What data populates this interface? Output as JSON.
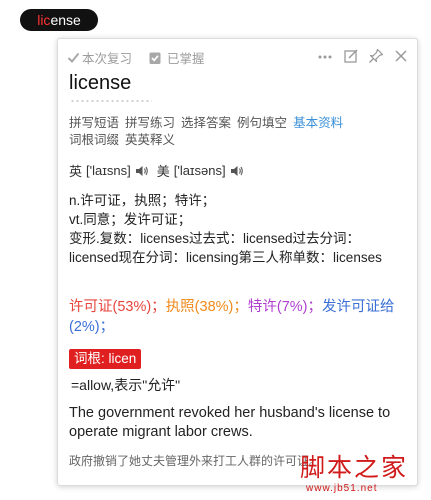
{
  "word_pill": {
    "prefix": "lic",
    "rest": "ense"
  },
  "toolbar": {
    "review_label": "本次复习",
    "mastered_label": "已掌握"
  },
  "headword": "license",
  "menu": {
    "items": [
      "拼写短语",
      "拼写练习",
      "选择答案",
      "例句填空",
      "基本资料",
      "词根词缀",
      "英英释义"
    ],
    "active": "基本资料"
  },
  "phonetics": {
    "uk_label": "英",
    "uk": "['laɪsns]",
    "us_label": "美",
    "us": "['laɪsəns]"
  },
  "definitions": [
    "n.许可证，执照；特许；",
    "vt.同意；发许可证；",
    "变形.复数：licenses过去式：licensed过去分词：licensed现在分词：licensing第三人称单数：licenses"
  ],
  "frequencies": [
    {
      "text": "许可证(53%)；",
      "color": "#e8453c"
    },
    {
      "text": "执照(38%)；",
      "color": "#f08a1c"
    },
    {
      "text": "特许(7%)；",
      "color": "#b03fd0"
    },
    {
      "text": "发许可证给(2%)；",
      "color": "#3b6fd6"
    }
  ],
  "root": {
    "badge": "词根: licen",
    "meaning": "=allow,表示\"允许\""
  },
  "example": {
    "en": "The government revoked her husband's license to operate migrant labor crews.",
    "zh": "政府撤销了她丈夫管理外来打工人群的许可证。"
  },
  "watermark": {
    "cn": "脚本之家",
    "url": "www.jb51.net"
  },
  "colors": {
    "accent_link": "#3a8fd8",
    "root_badge": "#e02020",
    "watermark": "#d11a1a"
  }
}
